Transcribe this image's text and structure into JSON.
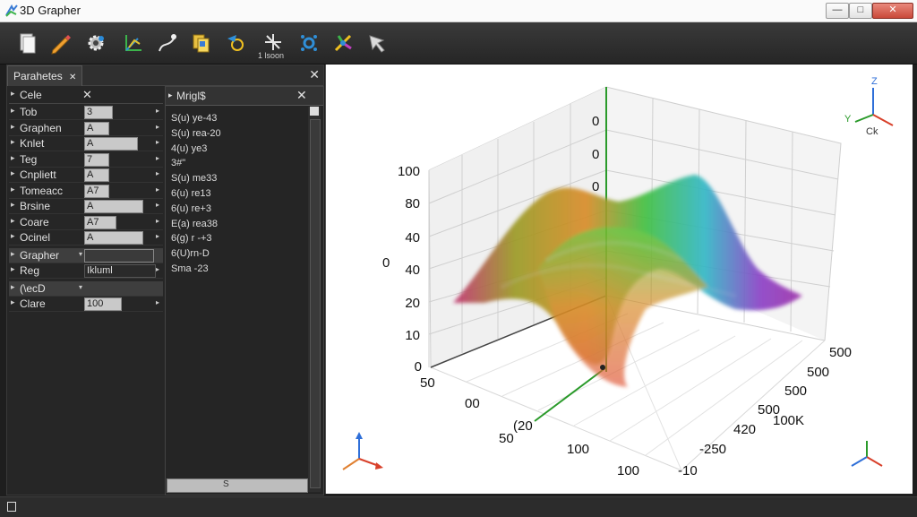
{
  "window": {
    "title": "3D Grapher",
    "min": "—",
    "max": "□",
    "close": "✕"
  },
  "toolbar": {
    "items": [
      {
        "name": "new-document-icon"
      },
      {
        "name": "pencil-icon"
      },
      {
        "name": "gear-icon"
      },
      {
        "name": "axes-icon"
      },
      {
        "name": "curve-tool-icon"
      },
      {
        "name": "copy-icon"
      },
      {
        "name": "rotate-icon"
      },
      {
        "name": "move-tool-icon"
      },
      {
        "name": "network-icon"
      },
      {
        "name": "transform-icon"
      },
      {
        "name": "pointer-icon"
      }
    ],
    "small_label": "1 lsoon"
  },
  "panel": {
    "tab_label": "Parahetes",
    "tab_close": "✕",
    "close": "✕",
    "params_header": "Cele",
    "params_header_close": "✕",
    "rows": [
      {
        "label": "Tob",
        "value": "3"
      },
      {
        "label": "Graphen",
        "value": "A"
      },
      {
        "label": "Knlet",
        "value": "A"
      },
      {
        "label": "Teg",
        "value": "7"
      },
      {
        "label": "Cnpliett",
        "value": "A"
      },
      {
        "label": "Tomeacc",
        "value": "A7"
      },
      {
        "label": "Brsine",
        "value": "A"
      },
      {
        "label": "Coare",
        "value": "A7"
      },
      {
        "label": "Ocinel",
        "value": "A"
      },
      {
        "label": "Grapher",
        "value": ""
      },
      {
        "label": "Reg",
        "value": "Ikluml"
      },
      {
        "label": "(\\ecD",
        "value": ""
      },
      {
        "label": "Clare",
        "value": "100"
      }
    ],
    "expr_header": "Mrigl$",
    "expr_close": "✕",
    "expressions": [
      "S(u) ye-43",
      "S(u) rea-20",
      "4(u) ye3",
      "3#\"",
      "S(u) me33",
      "6(u) re13",
      "6(u) re+3",
      "E(a) rea38",
      "6(g) r -+3",
      "6(U)rn-D",
      "Sma -23"
    ],
    "expr_footer": "S"
  },
  "chart_data": {
    "type": "surface",
    "title": "",
    "z_ticks": [
      "0",
      "10",
      "20",
      "40",
      "40",
      "80",
      "100"
    ],
    "z_label": "0",
    "wall_ticks": [
      "0",
      "0",
      "0"
    ],
    "left_axis_ticks": [
      "50",
      "00",
      "(20",
      "50",
      "100",
      "100"
    ],
    "right_axis_ticks": [
      "500",
      "500",
      "500",
      "500",
      "100K",
      "420",
      "-250",
      "-10"
    ],
    "grid": true,
    "surface": {
      "description_units": "z over x-y grid",
      "peaks": [
        "left ridge",
        "right ridge"
      ],
      "colors": [
        "#c0306e",
        "#9a9a20",
        "#d98a26",
        "#3fbf3f",
        "#2fb7c6",
        "#8a3fc6",
        "#9c2fa8"
      ]
    },
    "gizmo_labels": {
      "top_right_z": "Z",
      "top_right_y": "Y",
      "top_right_x": "Ck"
    }
  },
  "status": {
    "icon": "page-icon"
  }
}
